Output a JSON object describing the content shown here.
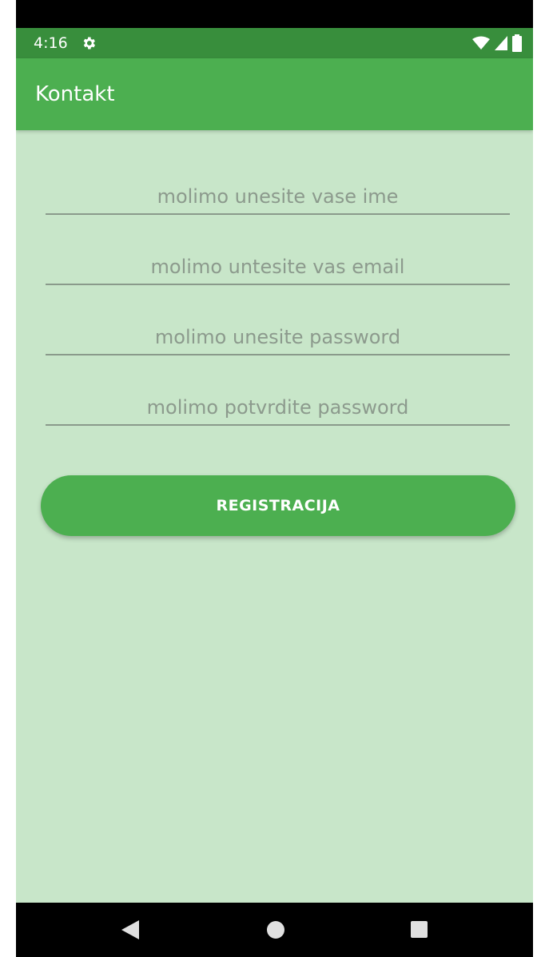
{
  "status_bar": {
    "time": "4:16",
    "icons": [
      "settings-gear-icon",
      "wifi-icon",
      "signal-icon",
      "battery-icon"
    ]
  },
  "app_bar": {
    "title": "Kontakt"
  },
  "form": {
    "name_placeholder": "molimo unesite vase ime",
    "email_placeholder": "molimo untesite vas email",
    "password_placeholder": "molimo unesite password",
    "confirm_password_placeholder": "molimo potvrdite password",
    "submit_label": "REGISTRACIJA"
  },
  "nav_bar": {
    "icons": [
      "back-icon",
      "home-icon",
      "recents-icon"
    ]
  },
  "colors": {
    "status_bar": "#388e3c",
    "app_bar": "#4caf50",
    "background": "#c8e6c9",
    "button": "#4caf50"
  }
}
